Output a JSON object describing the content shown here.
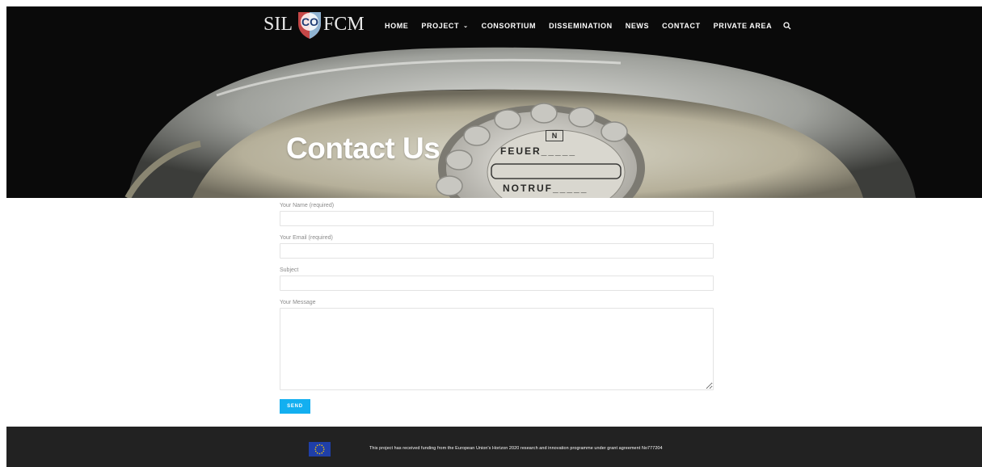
{
  "brand": {
    "logo_left": "SIL",
    "logo_mid": "CO",
    "logo_right": "FCM"
  },
  "nav": {
    "items": [
      {
        "label": "HOME"
      },
      {
        "label": "PROJECT"
      },
      {
        "label": "CONSORTIUM"
      },
      {
        "label": "DISSEMINATION"
      },
      {
        "label": "NEWS"
      },
      {
        "label": "CONTACT"
      },
      {
        "label": "PRIVATE AREA"
      }
    ],
    "search_icon": "search-icon",
    "caret_icon": "chevron-down-icon"
  },
  "hero": {
    "title": "Contact Us",
    "dial_text_top": "FEUER_____",
    "dial_text_bottom": "NOTRUF_____",
    "dial_logo": "N"
  },
  "form": {
    "name_label": "Your Name (required)",
    "email_label": "Your Email (required)",
    "subject_label": "Subject",
    "message_label": "Your Message",
    "name_value": "",
    "email_value": "",
    "subject_value": "",
    "message_value": "",
    "send_label": "SEND"
  },
  "footer": {
    "flag_icon": "eu-flag-icon",
    "text": "This project has received funding from the European Union's Horizon 2020 research and innovation programme under grant agreement No777204"
  },
  "colors": {
    "accent": "#13aff0",
    "footer_bg": "#222222",
    "eu_blue": "#1f3fa8",
    "eu_star": "#ffcc00"
  }
}
